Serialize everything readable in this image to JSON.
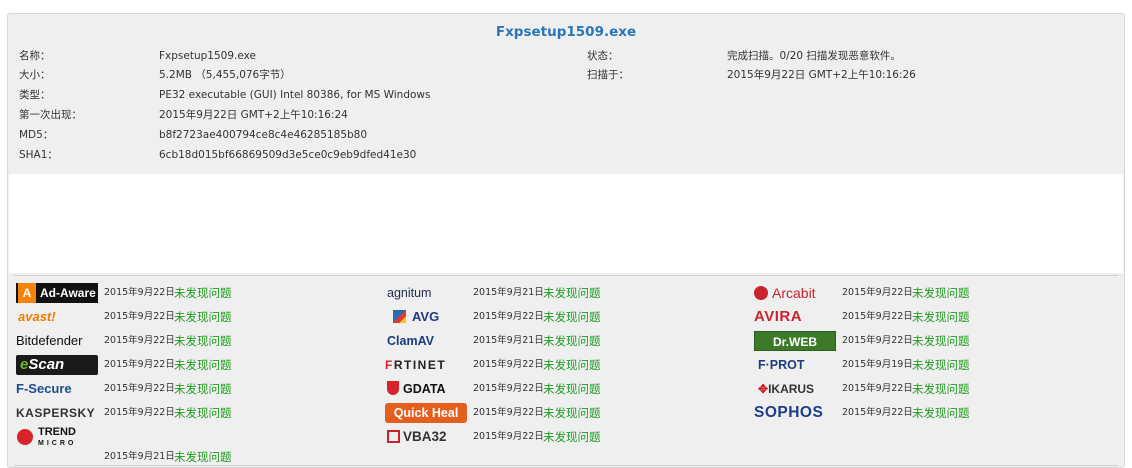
{
  "file": {
    "title": "Fxpsetup1509.exe",
    "left_fields": [
      {
        "label": "名称：",
        "value": "Fxpsetup1509.exe"
      },
      {
        "label": "大小：",
        "value": "5.2MB （5,455,076字节）"
      },
      {
        "label": "类型：",
        "value": "PE32 executable (GUI) Intel 80386, for MS Windows"
      },
      {
        "label": "第一次出现：",
        "value": "2015年9月22日 GMT+2上午10:16:24"
      },
      {
        "label": "MD5：",
        "value": "b8f2723ae400794ce8c4e46285185b80"
      },
      {
        "label": "SHA1：",
        "value": "6cb18d015bf66869509d3e5ce0c9eb9dfed41e30"
      }
    ],
    "right_fields": [
      {
        "label": "状态：",
        "value": "完成扫描。0/20 扫描发现恶意软件。"
      },
      {
        "label": "扫描于：",
        "value": "2015年9月22日 GMT+2上午10:16:26"
      }
    ]
  },
  "result_color": "#1f9c1f",
  "scanners": {
    "col1": [
      {
        "name": "Ad-Aware",
        "date": "2015年9月22日",
        "result": "未发现问题"
      },
      {
        "name": "avast!",
        "date": "2015年9月22日",
        "result": "未发现问题"
      },
      {
        "name": "Bitdefender",
        "date": "2015年9月22日",
        "result": "未发现问题"
      },
      {
        "name": "eScan",
        "date": "2015年9月22日",
        "result": "未发现问题"
      },
      {
        "name": "F-Secure",
        "date": "2015年9月22日",
        "result": "未发现问题"
      },
      {
        "name": "KASPERSKY",
        "date": "2015年9月22日",
        "result": "未发现问题"
      },
      {
        "name": "TREND MICRO",
        "date": "2015年9月21日",
        "result": "未发现问题"
      }
    ],
    "col2": [
      {
        "name": "agnitum",
        "date": "2015年9月21日",
        "result": "未发现问题"
      },
      {
        "name": "AVG",
        "date": "2015年9月22日",
        "result": "未发现问题"
      },
      {
        "name": "ClamAV",
        "date": "2015年9月21日",
        "result": "未发现问题"
      },
      {
        "name": "FORTINET",
        "date": "2015年9月22日",
        "result": "未发现问题"
      },
      {
        "name": "GDATA",
        "date": "2015年9月22日",
        "result": "未发现问题"
      },
      {
        "name": "Quick Heal",
        "date": "2015年9月22日",
        "result": "未发现问题"
      },
      {
        "name": "VBA32",
        "date": "2015年9月22日",
        "result": "未发现问题"
      }
    ],
    "col3": [
      {
        "name": "Arcabit",
        "date": "2015年9月22日",
        "result": "未发现问题"
      },
      {
        "name": "AVIRA",
        "date": "2015年9月22日",
        "result": "未发现问题"
      },
      {
        "name": "Dr.WEB",
        "date": "2015年9月22日",
        "result": "未发现问题"
      },
      {
        "name": "F-PROT",
        "date": "2015年9月19日",
        "result": "未发现问题"
      },
      {
        "name": "IKARUS",
        "date": "2015年9月22日",
        "result": "未发现问题"
      },
      {
        "name": "SOPHOS",
        "date": "2015年9月22日",
        "result": "未发现问题"
      }
    ]
  },
  "logos": {
    "adaware_mark": "A",
    "adaware_text": "Ad-Aware",
    "avast_text": "avast!",
    "bitdefender_text": "Bitdefender",
    "escan_e": "e",
    "escan_text": "Scan",
    "fsecure_text": "F-Secure",
    "kaspersky_text": "KASPERSKY",
    "trend_top": "TREND",
    "trend_bottom": "MICRO",
    "agnitum_text": "agnitum",
    "avg_text": "AVG",
    "clam_text": "ClamAV",
    "forti_f": "F",
    "forti_text": "RTINET",
    "gdata_text": "GDATA",
    "quickheal_text": "Quick Heal",
    "vba_text": "VBA32",
    "arcabit_text": "Arcabit",
    "avira_text": "AVIRA",
    "drweb_text": "Dr.WEB",
    "fprot_text": "F·PROT",
    "ikarus_i": "✥",
    "ikarus_text": "IKARUS",
    "sophos_text": "SOPHOS"
  }
}
